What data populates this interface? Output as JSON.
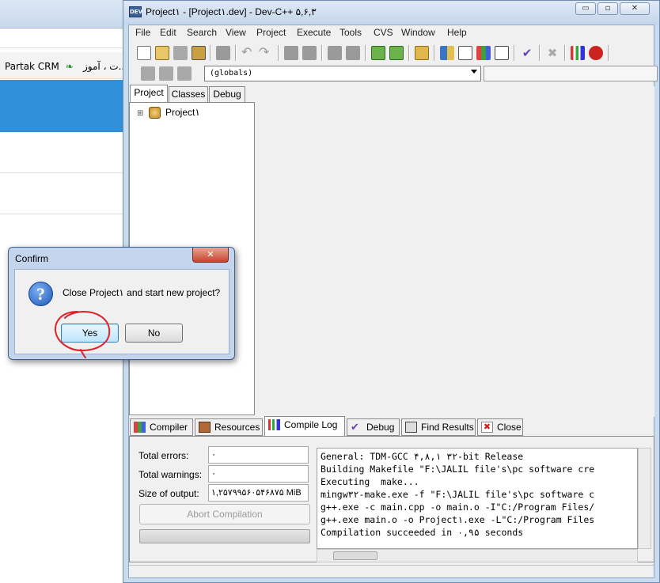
{
  "background_browser": {
    "bookmarks": [
      "ت ، آموز...",
      "Partak CRM"
    ]
  },
  "window": {
    "title": "Project۱ - [Project۱.dev] - Dev-C++ ۵,۶,۳",
    "minimize": "▭",
    "maximize": "▫",
    "close": "✕"
  },
  "menu": [
    "File",
    "Edit",
    "Search",
    "View",
    "Project",
    "Execute",
    "Tools",
    "CVS",
    "Window",
    "Help"
  ],
  "toolbar": {
    "globals_value": "(globals)"
  },
  "left_tabs": [
    "Project",
    "Classes",
    "Debug"
  ],
  "project_tree": {
    "expander": "⊞",
    "root": "Project۱"
  },
  "bottom_tabs": [
    "Compiler",
    "Resources",
    "Compile Log",
    "Debug",
    "Find Results",
    "Close"
  ],
  "compile_stats": {
    "errors_label": "Total errors:",
    "errors_value": "۰",
    "warnings_label": "Total warnings:",
    "warnings_value": "۰",
    "size_label": "Size of output:",
    "size_value": "۱,۲۵۷۹۹۵۶۰۵۴۶۸۷۵ MiB",
    "abort_label": "Abort Compilation"
  },
  "log_lines": [
    "General: TDM-GCC ۴,۸,۱ ۳۲-bit Release",
    "Building Makefile \"F:\\JALIL file's\\pc software cre",
    "Executing  make...",
    "mingw۳۲-make.exe -f \"F:\\JALIL file's\\pc software c",
    "g++.exe -c main.cpp -o main.o -I\"C:/Program Files/",
    "g++.exe main.o -o Project۱.exe -L\"C:/Program Files",
    "Compilation succeeded in ۰,۹۵ seconds"
  ],
  "dialog": {
    "title": "Confirm",
    "close": "✕",
    "icon": "?",
    "message": "Close Project۱ and start new project?",
    "yes": "Yes",
    "no": "No"
  },
  "colors": {
    "annotation_circle": "#e0202a",
    "accent_blue": "#2f8fd9"
  }
}
